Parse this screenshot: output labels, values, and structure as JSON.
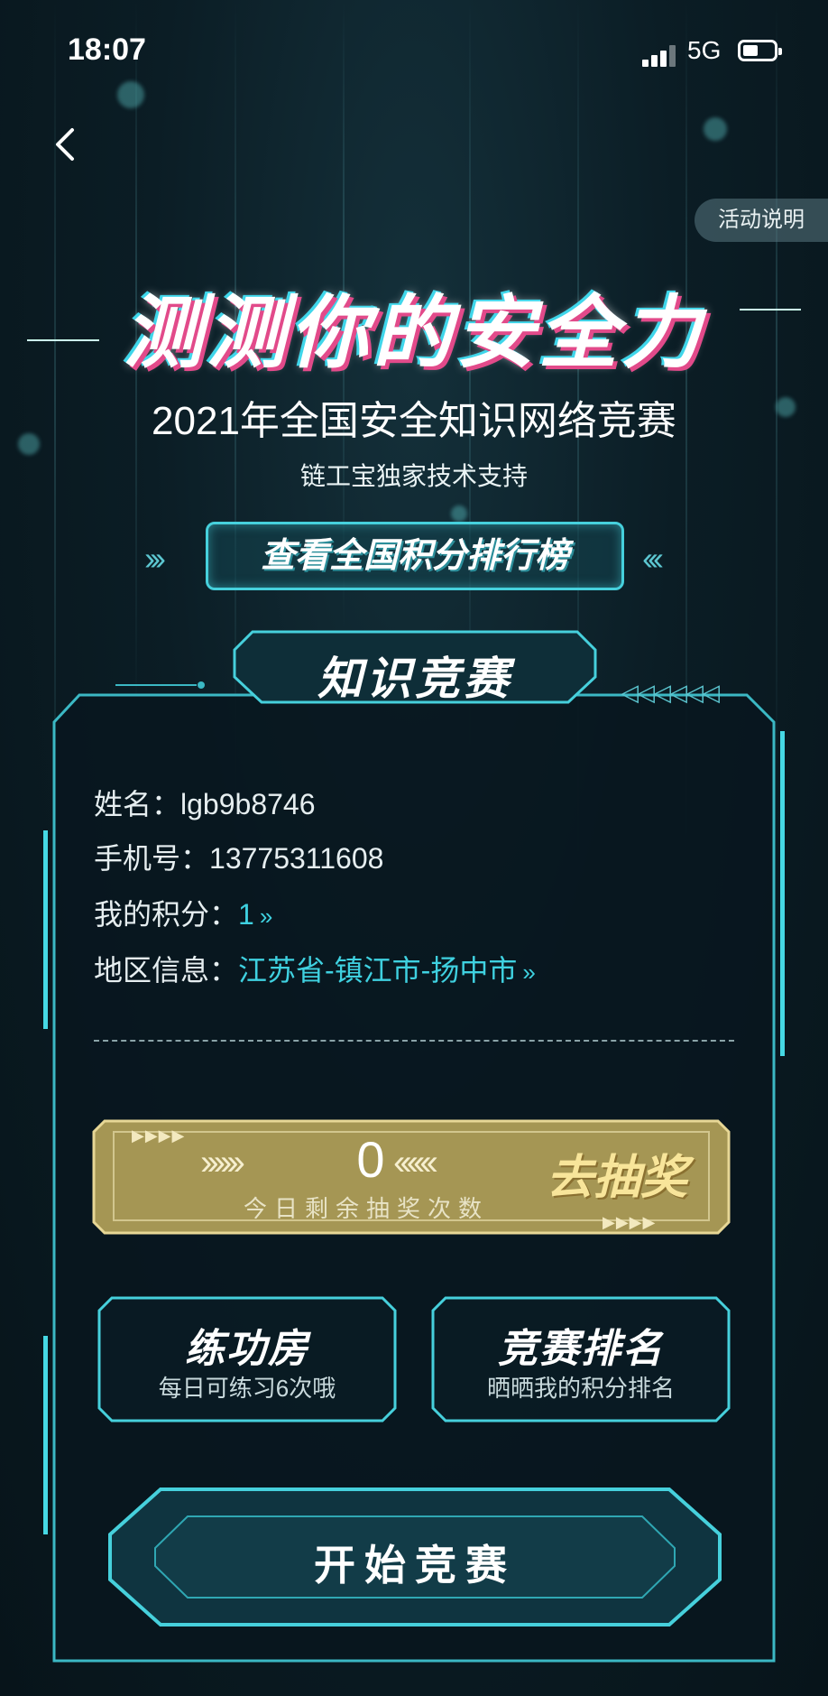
{
  "status_bar": {
    "time": "18:07",
    "network": "5G"
  },
  "header": {
    "rules_label": "活动说明"
  },
  "hero": {
    "title": "测测你的安全力",
    "subtitle": "2021年全国安全知识网络竞赛",
    "support": "链工宝独家技术支持",
    "rank_button": "查看全国积分排行榜"
  },
  "panel": {
    "title": "知识竞赛",
    "name_label": "姓名：",
    "name_value": "lgb9b8746",
    "phone_label": "手机号：",
    "phone_value": "13775311608",
    "score_label": "我的积分：",
    "score_value": "1",
    "region_label": "地区信息：",
    "region_value": "江苏省-镇江市-扬中市"
  },
  "lottery": {
    "remaining_count": "0",
    "remaining_label": "今日剩余抽奖次数",
    "go_label": "去抽奖"
  },
  "cards": {
    "practice_title": "练功房",
    "practice_sub": "每日可练习6次哦",
    "ranking_title": "竞赛排名",
    "ranking_sub": "晒晒我的积分排名"
  },
  "start_button": "开始竞赛",
  "colors": {
    "accent": "#3fd1e0",
    "background": "#0b1d25",
    "gold": "#c9b46a"
  }
}
